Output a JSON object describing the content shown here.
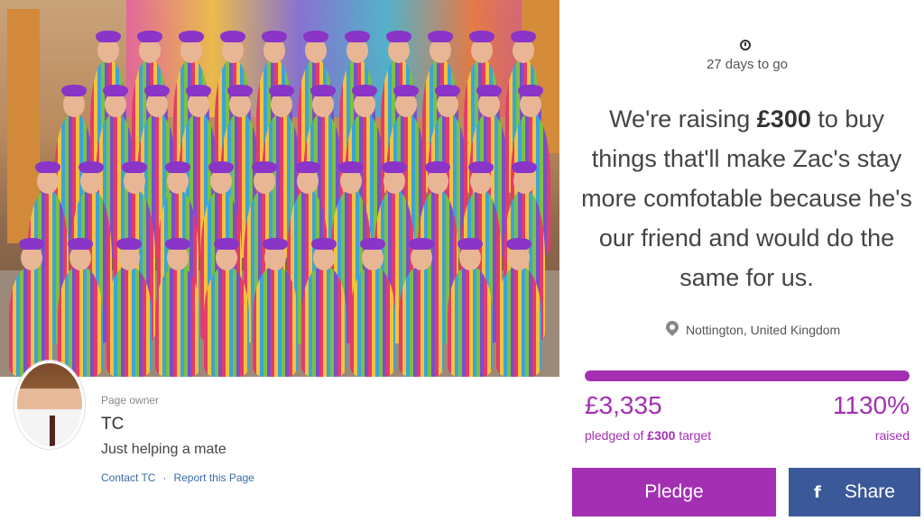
{
  "campaign": {
    "days_to_go": "27 days to go",
    "headline_pre": "We're raising ",
    "headline_amount": "£300",
    "headline_post": " to buy things that'll make Zac's stay more comfotable because he's our friend and would do the same for us.",
    "location": "Nottington, United Kingdom"
  },
  "funding": {
    "pledged_amount": "£3,335",
    "pledged_prefix": "pledged of ",
    "target_amount": "£300",
    "target_suffix": " target",
    "percent": "1130%",
    "raised_label": "raised",
    "progress_fraction": 1.0
  },
  "actions": {
    "pledge_label": "Pledge",
    "share_label": "Share",
    "share_icon": "f"
  },
  "owner": {
    "caption": "Page owner",
    "name": "TC",
    "tagline": "Just helping a mate",
    "contact_label": "Contact TC",
    "separator": "·",
    "report_label": "Report this Page"
  },
  "colors": {
    "accent": "#a32fb3",
    "facebook": "#3b5998",
    "link": "#3a6aa8"
  },
  "icons": {
    "clock": "clock-icon",
    "location": "map-pin-icon",
    "facebook": "facebook-icon"
  }
}
